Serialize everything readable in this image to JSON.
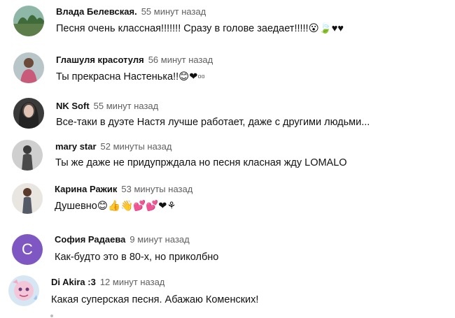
{
  "comments": [
    {
      "author": "Влада Белевская.",
      "time": "55 минут назад",
      "text": "Песня очень классная!!!!!!! Сразу в голове заедает!!!!!😮🍃♥♥",
      "avatar": "photo-avatar"
    },
    {
      "author": "Глашуля красотуля",
      "time": "56 минут назад",
      "text": "Ты прекрасна Настенька!!😊❤▫▫",
      "avatar": "photo-avatar"
    },
    {
      "author": "NK Soft",
      "time": "55 минут назад",
      "text": "Все-таки в дуэте Настя лучше работает, даже с другими людьми...",
      "avatar": "photo-avatar"
    },
    {
      "author": "mary star",
      "time": "52 минуты назад",
      "text": "Ты же даже не придупрждала но песня класная жду LOMALO",
      "avatar": "photo-avatar"
    },
    {
      "author": "Карина Ражик",
      "time": "53 минуты назад",
      "text": "Душевно😊👍👋💕💕❤⚘",
      "avatar": "photo-avatar"
    },
    {
      "author": "София Радаева",
      "time": "9 минут назад",
      "text": "Как-будто это в 80-х, но приколбно",
      "avatar_letter": "С",
      "avatar_color": "#7e57c2"
    },
    {
      "author": "Di Akira :3",
      "time": "12 минут назад",
      "text": "Какая суперская песня. Абажаю Коменских!",
      "avatar": "photo-avatar"
    }
  ]
}
